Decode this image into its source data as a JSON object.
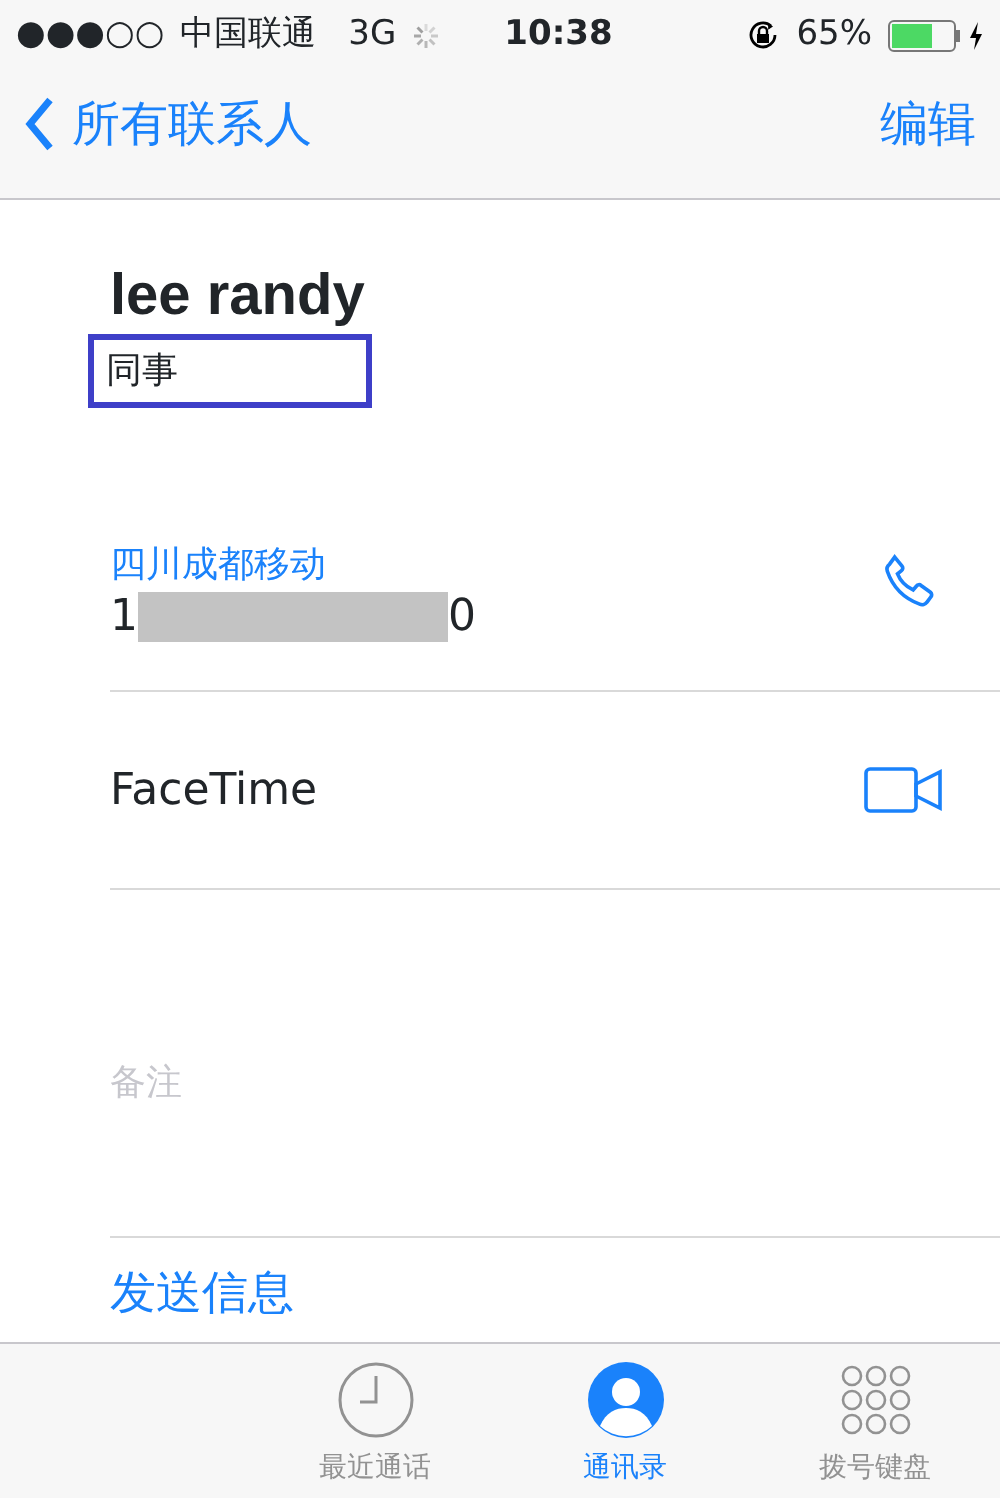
{
  "status_bar": {
    "signal_dots": "●●●○○",
    "carrier": "中国联通",
    "network": "3G",
    "time": "10:38",
    "battery_text": "65%"
  },
  "nav": {
    "back": "所有联系人",
    "action": "编辑"
  },
  "contact": {
    "name": "lee randy",
    "subtitle": "同事",
    "subtitle_highlighted": true
  },
  "fields": [
    {
      "kind": "phone",
      "label": "四川成都移动",
      "value_start": "1",
      "value_end": "0"
    },
    {
      "kind": "facetime",
      "label": "FaceTime"
    },
    {
      "kind": "notes",
      "placeholder": "备注"
    }
  ],
  "send_message": "发送信息",
  "tab_bar": [
    {
      "kind": "clock",
      "label": "最近通话",
      "selected": false
    },
    {
      "kind": "person",
      "label": "通讯录",
      "selected": true
    },
    {
      "kind": "keypad",
      "label": "拨号键盘",
      "selected": false
    }
  ]
}
